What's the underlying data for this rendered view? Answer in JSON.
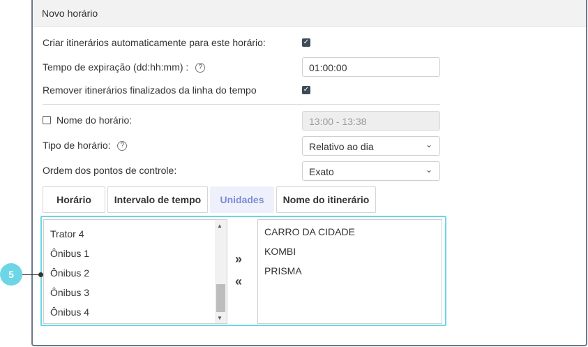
{
  "dialog": {
    "title": "Novo horário"
  },
  "settings": {
    "auto_create_label": "Criar itinerários automaticamente para este horário:",
    "expiration_label": "Tempo de expiração (dd:hh:mm)  :",
    "expiration_value": "01:00:00",
    "remove_finished_label": "Remover itinerários finalizados da linha do tempo",
    "schedule_name_label": "Nome do horário:",
    "schedule_name_placeholder": "13:00 - 13:38",
    "schedule_type_label": "Tipo de horário:",
    "schedule_type_value": "Relativo ao dia",
    "checkpoint_order_label": "Ordem dos pontos de controle:",
    "checkpoint_order_value": "Exato",
    "help_glyph": "?"
  },
  "tabs": [
    {
      "label": "Horário"
    },
    {
      "label": "Intervalo de tempo"
    },
    {
      "label": "Unidades"
    },
    {
      "label": "Nome do itinerário"
    }
  ],
  "units": {
    "available": [
      "Trator 4",
      "Ônibus 1",
      "Ônibus 2",
      "Ônibus 3",
      "Ônibus 4"
    ],
    "selected": [
      "CARRO DA CIDADE",
      "KOMBI",
      "PRISMA"
    ],
    "add_glyph": "»",
    "remove_glyph": "«"
  },
  "callout": {
    "number": "5"
  },
  "colors": {
    "accent": "#6cd6e6",
    "active_tab_text": "#7d8bd6",
    "checkbox": "#3d4a58"
  }
}
